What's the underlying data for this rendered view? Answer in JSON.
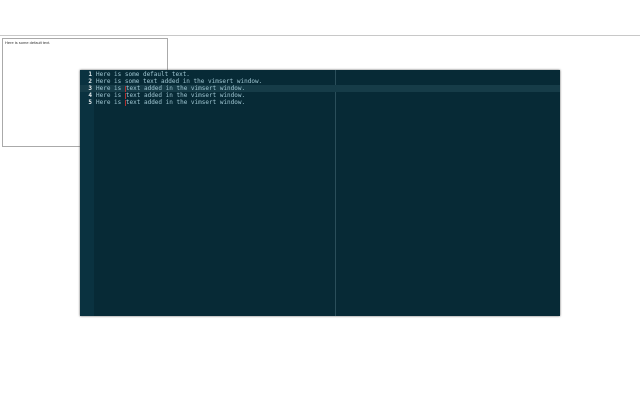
{
  "textarea": {
    "value": "Here is some default text."
  },
  "editor": {
    "cursor_line": 3,
    "lines": [
      {
        "num": "1",
        "pre": "Here is some default text.",
        "post": ""
      },
      {
        "num": "2",
        "pre": "Here is some text added in the vimsert window.",
        "post": ""
      },
      {
        "num": "3",
        "pre": "Here is ",
        "post": "text added in the vimsert window."
      },
      {
        "num": "4",
        "pre": "Here is ",
        "post": "text added in the vimsert window."
      },
      {
        "num": "5",
        "pre": "Here is ",
        "post": "text added in the vimsert window."
      }
    ]
  },
  "colors": {
    "bg": "#072a36",
    "cursorline": "#163c48",
    "text": "#9fc6d2",
    "marker": "#b03030"
  }
}
